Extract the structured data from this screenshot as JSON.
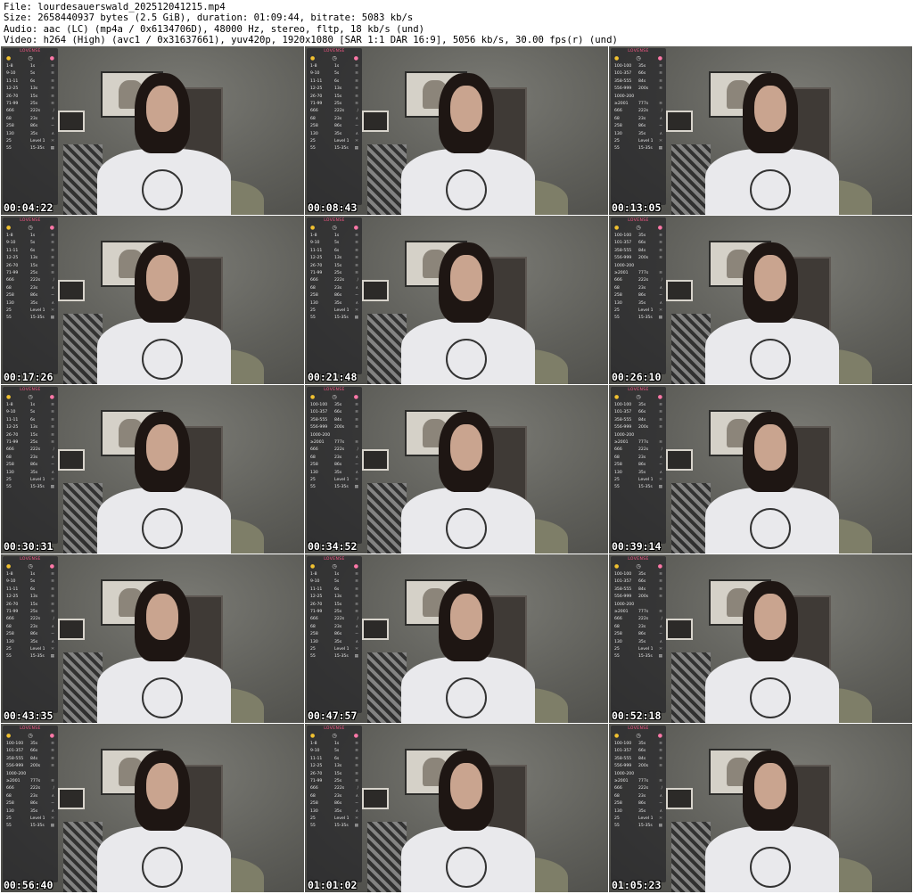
{
  "header": {
    "file": "File: lourdesauerswald_202512041215.mp4",
    "size": "Size: 2658440937 bytes (2.5 GiB), duration: 01:09:44, bitrate: 5083 kb/s",
    "audio": "Audio: aac (LC) (mp4a / 0x6134706D), 48000 Hz, stereo, fltp, 18 kb/s (und)",
    "video": "Video: h264 (High) (avc1 / 0x31637661), yuv420p, 1920x1080 [SAR 1:1 DAR 16:9], 5056 kb/s, 30.00 fps(r) (und)"
  },
  "overlay": {
    "title": "LOVENSE",
    "icons": [
      "coin-icon",
      "clock-icon",
      "pink-dot-icon"
    ],
    "set_a": [
      {
        "amount": "100-100",
        "duration": "35s",
        "symbol": "≋"
      },
      {
        "amount": "101-357",
        "duration": "66s",
        "symbol": "≋"
      },
      {
        "amount": "358-555",
        "duration": "84s",
        "symbol": "≋"
      },
      {
        "amount": "556-999",
        "duration": "200s",
        "symbol": "≋"
      },
      {
        "amount": "1000-2000444s",
        "duration": "",
        "symbol": ""
      },
      {
        "amount": "≥2001",
        "duration": "777s",
        "symbol": "≋"
      },
      {
        "amount": "666",
        "duration": "222s",
        "symbol": "∕"
      },
      {
        "amount": "68",
        "duration": "23s",
        "symbol": "∧"
      },
      {
        "amount": "258",
        "duration": "86s",
        "symbol": "∼"
      },
      {
        "amount": "130",
        "duration": "35s",
        "symbol": "∧"
      },
      {
        "amount": "25",
        "duration": "Level 1-5",
        "symbol": "≍"
      },
      {
        "amount": "55",
        "duration": "15-35s",
        "symbol": "▦"
      }
    ],
    "set_b": [
      {
        "amount": "1-8",
        "duration": "1s",
        "symbol": "≋"
      },
      {
        "amount": "9-10",
        "duration": "5s",
        "symbol": "≋"
      },
      {
        "amount": "11-11",
        "duration": "6s",
        "symbol": "≋"
      },
      {
        "amount": "12-25",
        "duration": "13s",
        "symbol": "≋"
      },
      {
        "amount": "26-70",
        "duration": "15s",
        "symbol": "≋"
      },
      {
        "amount": "71-99",
        "duration": "25s",
        "symbol": "≋"
      },
      {
        "amount": "666",
        "duration": "222s",
        "symbol": "∕"
      },
      {
        "amount": "68",
        "duration": "23s",
        "symbol": "∧"
      },
      {
        "amount": "258",
        "duration": "86s",
        "symbol": "∼"
      },
      {
        "amount": "130",
        "duration": "35s",
        "symbol": "∧"
      },
      {
        "amount": "25",
        "duration": "Level 1-5",
        "symbol": "≍"
      },
      {
        "amount": "55",
        "duration": "15-35s",
        "symbol": "▦"
      }
    ]
  },
  "thumbnails": [
    {
      "time": "00:04:22",
      "set": "set_b"
    },
    {
      "time": "00:08:43",
      "set": "set_b"
    },
    {
      "time": "00:13:05",
      "set": "set_a"
    },
    {
      "time": "00:17:26",
      "set": "set_b"
    },
    {
      "time": "00:21:48",
      "set": "set_b"
    },
    {
      "time": "00:26:10",
      "set": "set_a"
    },
    {
      "time": "00:30:31",
      "set": "set_b"
    },
    {
      "time": "00:34:52",
      "set": "set_a"
    },
    {
      "time": "00:39:14",
      "set": "set_a"
    },
    {
      "time": "00:43:35",
      "set": "set_b"
    },
    {
      "time": "00:47:57",
      "set": "set_b"
    },
    {
      "time": "00:52:18",
      "set": "set_a"
    },
    {
      "time": "00:56:40",
      "set": "set_a"
    },
    {
      "time": "01:01:02",
      "set": "set_b"
    },
    {
      "time": "01:05:23",
      "set": "set_a"
    }
  ]
}
